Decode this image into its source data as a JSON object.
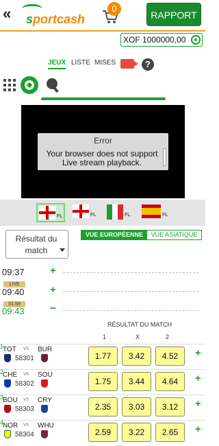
{
  "header": {
    "back_glyph": "«",
    "logo_text_s": "s",
    "logo_text_rest": "portcash",
    "cart_count": "0",
    "report_label": "RAPPORT"
  },
  "balance": {
    "amount": "XOF 1000000,00",
    "icon": "refresh-icon"
  },
  "tabs": [
    {
      "label": "JEUX",
      "active": true
    },
    {
      "label": "LISTE",
      "active": false
    },
    {
      "label": "MISES",
      "active": false
    }
  ],
  "icons": {
    "video": "video-camera-icon",
    "help": "help-icon",
    "help_glyph": "?",
    "grid": "grid-icon",
    "soccer": "soccer-ball-icon",
    "tennis": "table-tennis-icon"
  },
  "video": {
    "error_title": "Error",
    "error_line1": "Your browser does not support",
    "error_line2": "Live stream playback."
  },
  "flags": [
    {
      "country": "England",
      "league": "FL",
      "selected": true
    },
    {
      "country": "England",
      "league": "FL",
      "selected": false
    },
    {
      "country": "Italy",
      "league": "FL",
      "selected": false
    },
    {
      "country": "Spain",
      "league": "FL",
      "selected": false
    }
  ],
  "market": {
    "line1": "Résultat du",
    "line2": "match"
  },
  "view_toggle": {
    "european": "VUE EUROPÉENNE",
    "asian": "VUE ASIATIQUE"
  },
  "slots": [
    {
      "time": "09:37",
      "badge": "",
      "sign": "+"
    },
    {
      "time": "09:40",
      "badge": "LIVE",
      "sign": "+"
    },
    {
      "time": "09:43",
      "badge": "01:59",
      "sign": "−"
    }
  ],
  "odds_header": {
    "title": "RÉSULTAT DU MATCH",
    "col1": "1",
    "colx": "X",
    "col2": "2"
  },
  "matches": [
    {
      "num": "1",
      "home": "TOT",
      "away": "BUR",
      "vs": "VS",
      "id": "58301",
      "odds": [
        "1.77",
        "3.42",
        "4.52"
      ],
      "plus": "+",
      "home_color": "#1b2a6e",
      "away_color": "#6b2037"
    },
    {
      "num": "2",
      "home": "CHE",
      "away": "SOU",
      "vs": "VS",
      "id": "58302",
      "odds": [
        "1.75",
        "3.44",
        "4.64"
      ],
      "plus": "+",
      "home_color": "#0a3aa8",
      "away_color": "#d71920"
    },
    {
      "num": "3",
      "home": "BOU",
      "away": "CRY",
      "vs": "VS",
      "id": "58303",
      "odds": [
        "2.35",
        "3.03",
        "3.12"
      ],
      "plus": "+",
      "home_color": "#b50e12",
      "away_color": "#1b458f"
    },
    {
      "num": "4",
      "home": "NOR",
      "away": "WHU",
      "vs": "VS",
      "id": "58304",
      "odds": [
        "2.59",
        "3.22",
        "2.65"
      ],
      "plus": "+",
      "home_color": "#fff200",
      "away_color": "#7a263a"
    }
  ]
}
